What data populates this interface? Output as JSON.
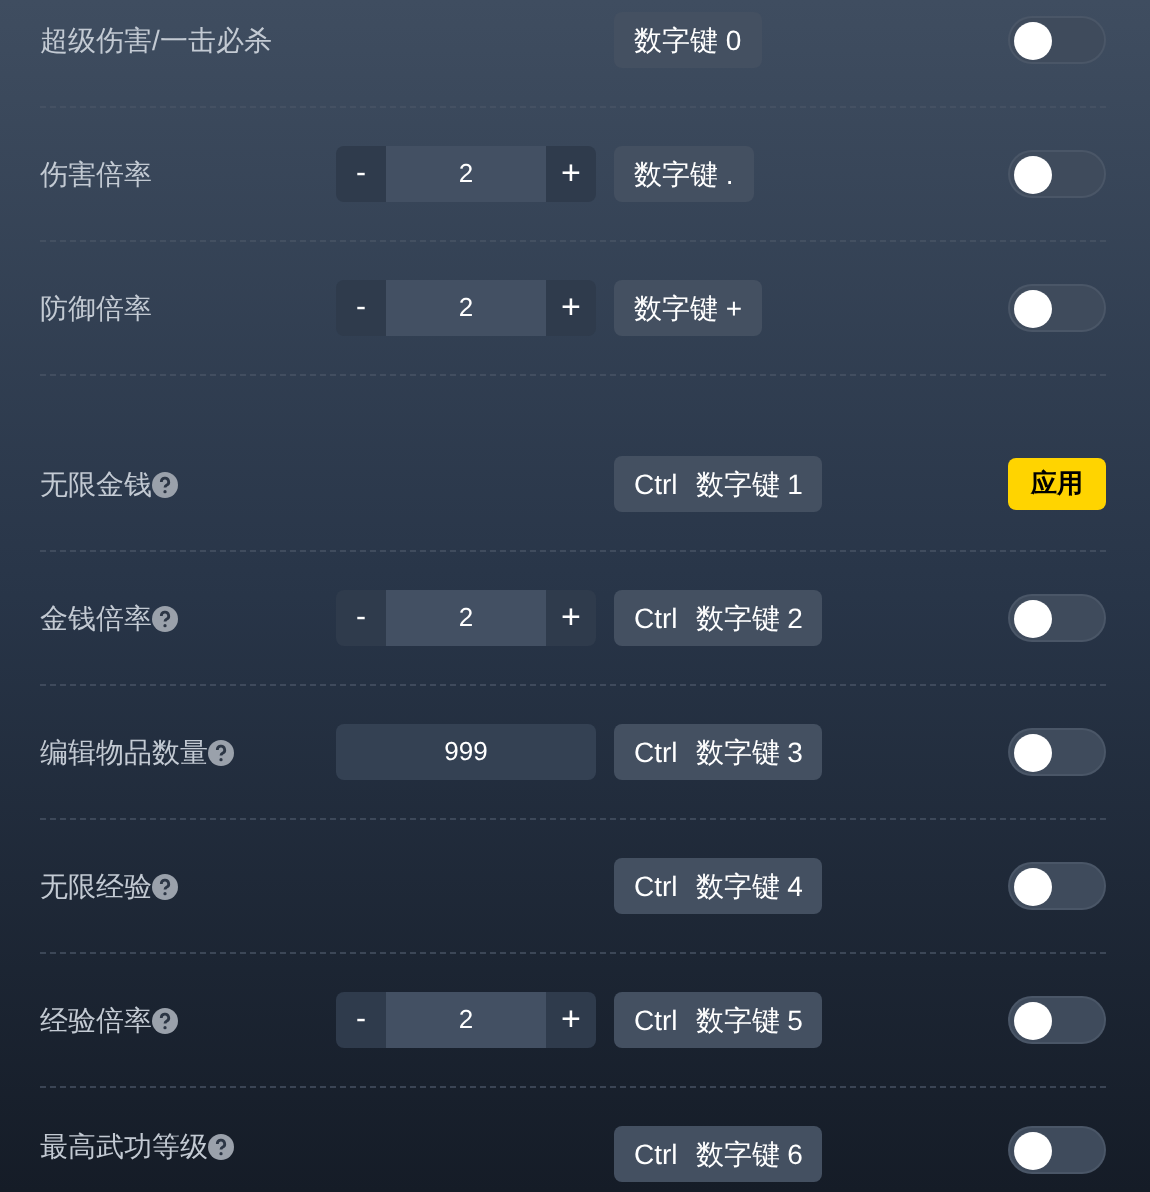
{
  "rows": [
    {
      "label": "超级伤害/一击必杀",
      "help": false,
      "control": {
        "kind": "none"
      },
      "hotkey": [
        "数字键 0"
      ],
      "action": {
        "kind": "toggle",
        "on": false
      },
      "section_start": false
    },
    {
      "label": "伤害倍率",
      "help": false,
      "control": {
        "kind": "stepper",
        "minus": "-",
        "value": "2",
        "plus": "+"
      },
      "hotkey": [
        "数字键 ."
      ],
      "action": {
        "kind": "toggle",
        "on": false
      },
      "section_start": false
    },
    {
      "label": "防御倍率",
      "help": false,
      "control": {
        "kind": "stepper",
        "minus": "-",
        "value": "2",
        "plus": "+"
      },
      "hotkey": [
        "数字键 +"
      ],
      "action": {
        "kind": "toggle",
        "on": false
      },
      "section_start": false
    },
    {
      "label": "无限金钱",
      "help": true,
      "control": {
        "kind": "none"
      },
      "hotkey": [
        "Ctrl",
        "数字键 1"
      ],
      "action": {
        "kind": "button",
        "label": "应用"
      },
      "section_start": true
    },
    {
      "label": "金钱倍率",
      "help": true,
      "control": {
        "kind": "stepper",
        "minus": "-",
        "value": "2",
        "plus": "+"
      },
      "hotkey": [
        "Ctrl",
        "数字键 2"
      ],
      "action": {
        "kind": "toggle",
        "on": false
      },
      "section_start": false
    },
    {
      "label": "编辑物品数量",
      "help": true,
      "control": {
        "kind": "input",
        "value": "999"
      },
      "hotkey": [
        "Ctrl",
        "数字键 3"
      ],
      "action": {
        "kind": "toggle",
        "on": false
      },
      "section_start": false
    },
    {
      "label": "无限经验",
      "help": true,
      "control": {
        "kind": "none"
      },
      "hotkey": [
        "Ctrl",
        "数字键 4"
      ],
      "action": {
        "kind": "toggle",
        "on": false
      },
      "section_start": false
    },
    {
      "label": "经验倍率",
      "help": true,
      "control": {
        "kind": "stepper",
        "minus": "-",
        "value": "2",
        "plus": "+"
      },
      "hotkey": [
        "Ctrl",
        "数字键 5"
      ],
      "action": {
        "kind": "toggle",
        "on": false
      },
      "section_start": false
    },
    {
      "label": "最高武功等级",
      "help": true,
      "control": {
        "kind": "none"
      },
      "hotkey": [
        "Ctrl",
        "数字键 6"
      ],
      "action": {
        "kind": "toggle",
        "on": false
      },
      "section_start": false
    }
  ]
}
